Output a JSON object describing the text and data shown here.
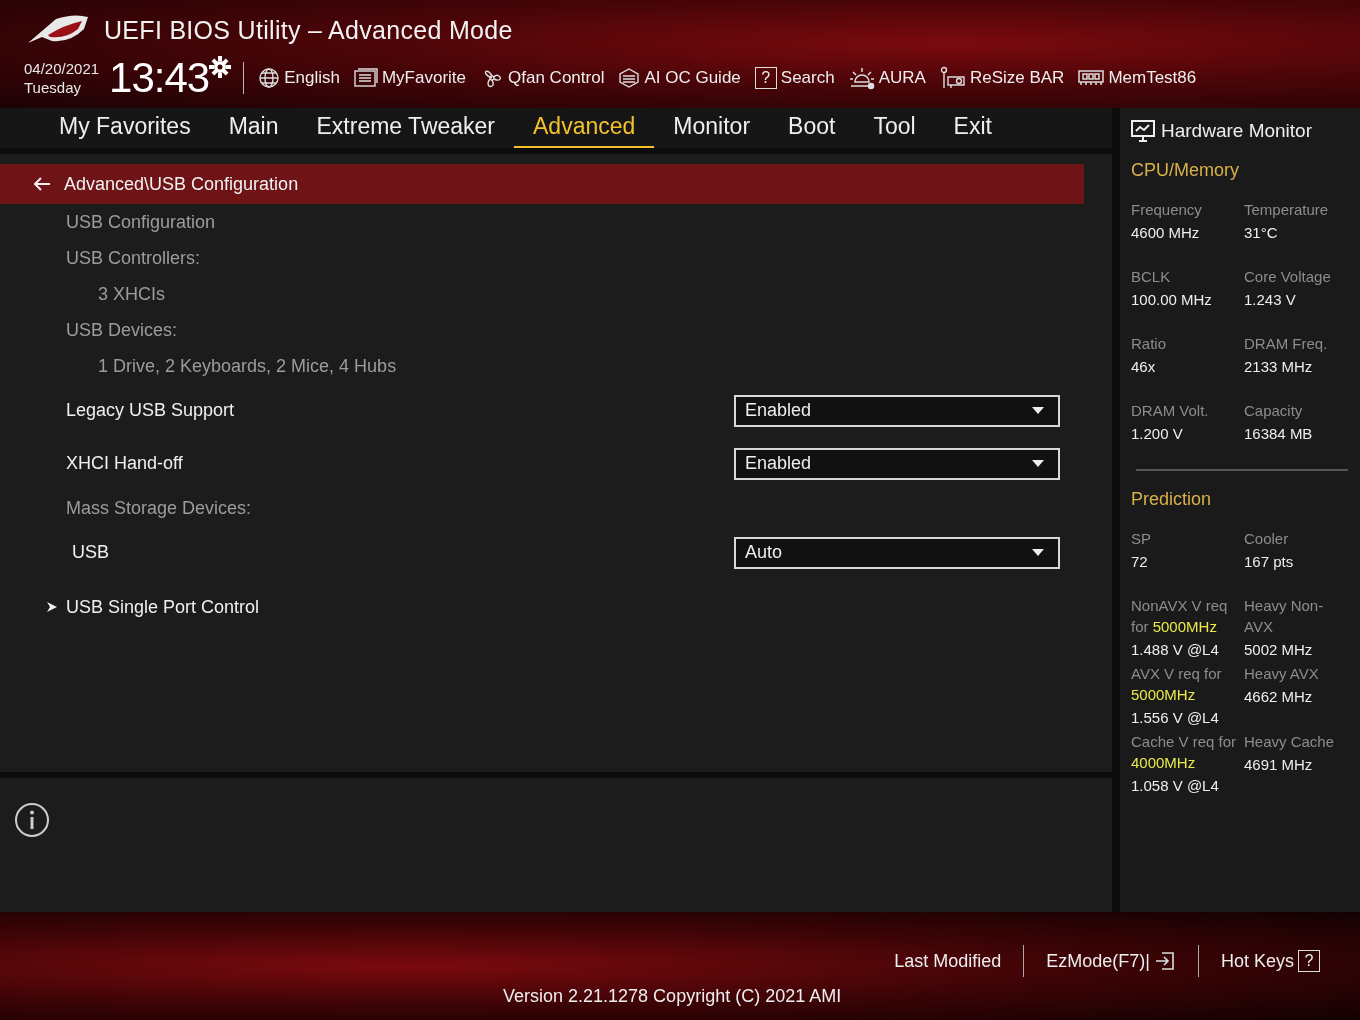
{
  "window": {
    "title": "UEFI BIOS Utility – Advanced Mode"
  },
  "clock": {
    "date": "04/20/2021",
    "weekday": "Tuesday",
    "time": "13:43"
  },
  "toolbar": [
    {
      "kind": "globe",
      "label": "English"
    },
    {
      "kind": "list",
      "label": "MyFavorite"
    },
    {
      "kind": "fan",
      "label": "Qfan Control"
    },
    {
      "kind": "chip",
      "label": "AI OC Guide"
    },
    {
      "kind": "help",
      "label": "Search",
      "glyph": "?"
    },
    {
      "kind": "sun",
      "label": "AURA"
    },
    {
      "kind": "card",
      "label": "ReSize BAR"
    },
    {
      "kind": "memory",
      "label": "MemTest86"
    }
  ],
  "tabs": [
    {
      "label": "My Favorites",
      "selected": false
    },
    {
      "label": "Main",
      "selected": false
    },
    {
      "label": "Extreme Tweaker",
      "selected": false
    },
    {
      "label": "Advanced",
      "selected": true
    },
    {
      "label": "Monitor",
      "selected": false
    },
    {
      "label": "Boot",
      "selected": false
    },
    {
      "label": "Tool",
      "selected": false
    },
    {
      "label": "Exit",
      "selected": false
    }
  ],
  "breadcrumb": "Advanced\\USB Configuration",
  "settings": [
    {
      "kind": "heading",
      "label": "USB Configuration"
    },
    {
      "kind": "heading",
      "label": "USB Controllers:"
    },
    {
      "kind": "info",
      "label": "3 XHCIs"
    },
    {
      "kind": "heading",
      "label": "USB Devices:"
    },
    {
      "kind": "info",
      "label": "1 Drive, 2 Keyboards, 2 Mice, 4 Hubs"
    },
    {
      "kind": "option",
      "label": "Legacy USB Support",
      "value": "Enabled"
    },
    {
      "kind": "option",
      "label": "XHCI Hand-off",
      "value": "Enabled"
    },
    {
      "kind": "heading",
      "label": "Mass Storage Devices:"
    },
    {
      "kind": "option",
      "label": "USB",
      "value": "Auto",
      "indent": true
    },
    {
      "kind": "submenu",
      "label": "USB Single Port Control"
    }
  ],
  "hardware_monitor": {
    "title": "Hardware Monitor",
    "sections": [
      {
        "title": "CPU/Memory",
        "rows": [
          [
            {
              "label": "Frequency",
              "value": "4600 MHz"
            },
            {
              "label": "Temperature",
              "value": "31°C"
            }
          ],
          [
            {
              "label": "BCLK",
              "value": "100.00 MHz"
            },
            {
              "label": "Core Voltage",
              "value": "1.243 V"
            }
          ],
          [
            {
              "label": "Ratio",
              "value": "46x"
            },
            {
              "label": "DRAM Freq.",
              "value": "2133 MHz"
            }
          ],
          [
            {
              "label": "DRAM Volt.",
              "value": "1.200 V"
            },
            {
              "label": "Capacity",
              "value": "16384 MB"
            }
          ]
        ]
      },
      {
        "title": "Prediction",
        "rows": [
          [
            {
              "label": "SP",
              "value": "72"
            },
            {
              "label": "Cooler",
              "value": "167 pts"
            }
          ],
          [
            {
              "label": "NonAVX V req for",
              "highlight": "5000MHz",
              "value": "1.488 V @L4"
            },
            {
              "label": "Heavy Non-AVX",
              "value": "5002 MHz"
            }
          ],
          [
            {
              "label": "AVX V req for",
              "highlight": "5000MHz",
              "value": "1.556 V @L4"
            },
            {
              "label": "Heavy AVX",
              "value": "4662 MHz"
            }
          ],
          [
            {
              "label": "Cache V req for",
              "highlight": "4000MHz",
              "value": "1.058 V @L4"
            },
            {
              "label": "Heavy Cache",
              "value": "4691 MHz"
            }
          ]
        ]
      }
    ]
  },
  "footer": {
    "links": [
      {
        "kind": "plain",
        "label": "Last Modified"
      },
      {
        "kind": "exit",
        "label": "EzMode(F7)|"
      },
      {
        "kind": "help",
        "label": "Hot Keys",
        "glyph": "?"
      }
    ],
    "version": "Version 2.21.1278 Copyright (C) 2021 AMI"
  }
}
